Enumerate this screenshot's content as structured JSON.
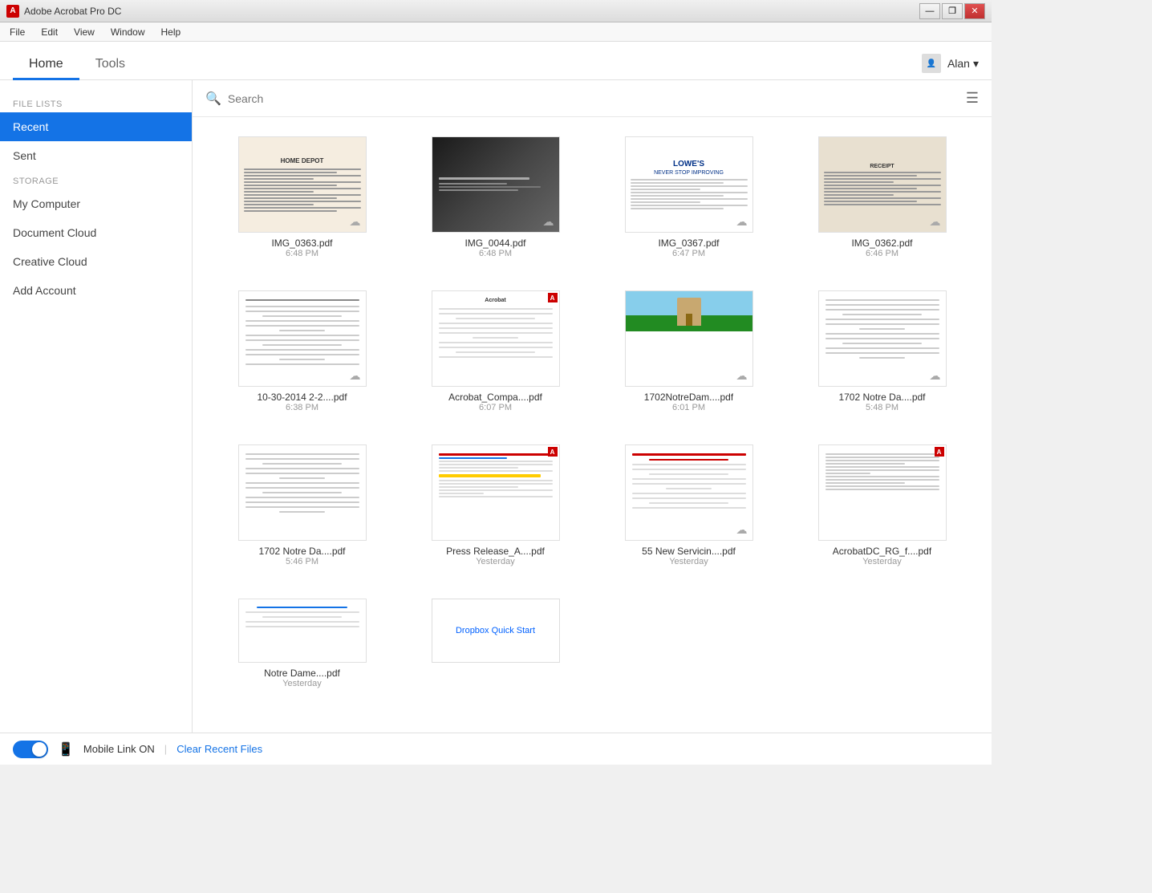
{
  "app": {
    "title": "Adobe Acrobat Pro DC",
    "icon": "A"
  },
  "menu": {
    "items": [
      "File",
      "Edit",
      "View",
      "Window",
      "Help"
    ]
  },
  "nav": {
    "tabs": [
      {
        "id": "home",
        "label": "Home",
        "active": true
      },
      {
        "id": "tools",
        "label": "Tools",
        "active": false
      }
    ],
    "user": "Alan",
    "dropdown_icon": "▾"
  },
  "sidebar": {
    "file_lists_label": "FILE LISTS",
    "storage_label": "STORAGE",
    "items": [
      {
        "id": "recent",
        "label": "Recent",
        "active": true,
        "section": "file_lists"
      },
      {
        "id": "sent",
        "label": "Sent",
        "active": false,
        "section": "file_lists"
      },
      {
        "id": "my-computer",
        "label": "My Computer",
        "active": false,
        "section": "storage"
      },
      {
        "id": "document-cloud",
        "label": "Document Cloud",
        "active": false,
        "section": "storage"
      },
      {
        "id": "creative-cloud",
        "label": "Creative Cloud",
        "active": false,
        "section": "storage"
      },
      {
        "id": "add-account",
        "label": "Add Account",
        "active": false,
        "section": "storage"
      }
    ]
  },
  "search": {
    "placeholder": "Search"
  },
  "files": [
    {
      "id": 1,
      "name": "IMG_0363.pdf",
      "time": "6:48 PM",
      "cloud": true,
      "thumb_type": "receipt"
    },
    {
      "id": 2,
      "name": "IMG_0044.pdf",
      "time": "6:48 PM",
      "cloud": true,
      "thumb_type": "dark"
    },
    {
      "id": 3,
      "name": "IMG_0367.pdf",
      "time": "6:47 PM",
      "cloud": true,
      "thumb_type": "lowes"
    },
    {
      "id": 4,
      "name": "IMG_0362.pdf",
      "time": "6:46 PM",
      "cloud": true,
      "thumb_type": "receipt2"
    },
    {
      "id": 5,
      "name": "10-30-2014 2-2....pdf",
      "time": "6:38 PM",
      "cloud": true,
      "thumb_type": "doc"
    },
    {
      "id": 6,
      "name": "Acrobat_Compa....pdf",
      "time": "6:07 PM",
      "cloud": false,
      "thumb_type": "adobe_doc"
    },
    {
      "id": 7,
      "name": "1702NotreDam....pdf",
      "time": "6:01 PM",
      "cloud": true,
      "thumb_type": "photo_doc"
    },
    {
      "id": 8,
      "name": "1702 Notre Da....pdf",
      "time": "5:48 PM",
      "cloud": true,
      "thumb_type": "text_doc"
    },
    {
      "id": 9,
      "name": "1702 Notre Da....pdf",
      "time": "5:46 PM",
      "cloud": false,
      "thumb_type": "text_doc2"
    },
    {
      "id": 10,
      "name": "Press Release_A....pdf",
      "time": "Yesterday",
      "cloud": false,
      "thumb_type": "press_release"
    },
    {
      "id": 11,
      "name": "55 New Servicin....pdf",
      "time": "Yesterday",
      "cloud": true,
      "thumb_type": "red_header"
    },
    {
      "id": 12,
      "name": "AcrobatDC_RG_f....pdf",
      "time": "Yesterday",
      "cloud": false,
      "thumb_type": "acrobat_doc"
    },
    {
      "id": 13,
      "name": "Notre Dame....pdf",
      "time": "Yesterday",
      "cloud": false,
      "thumb_type": "small_doc"
    },
    {
      "id": 14,
      "name": "Dropbox Quick Start",
      "time": "",
      "cloud": false,
      "thumb_type": "dropbox"
    }
  ],
  "bottom_bar": {
    "mobile_link_label": "Mobile Link ON",
    "separator": "|",
    "clear_recent": "Clear Recent Files",
    "toggle_on": true
  },
  "title_bar": {
    "minimize": "—",
    "restore": "❐",
    "close": "✕"
  }
}
